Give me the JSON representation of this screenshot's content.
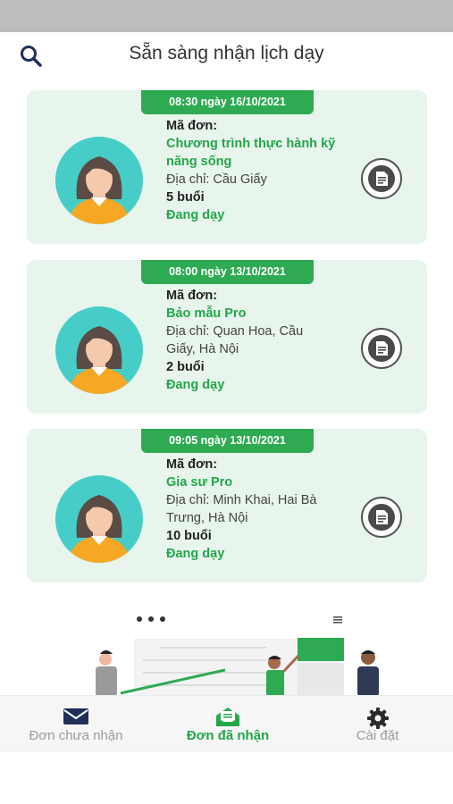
{
  "header": {
    "title": "Sẵn sàng nhận lịch dạy",
    "search_icon": "search-icon"
  },
  "orders": [
    {
      "time": "08:30 ngày 16/10/2021",
      "code_label": "Mã đơn:",
      "service_line1": "Chương trình thực hành kỹ",
      "service_line2": "năng sống",
      "address_line1": "Địa chỉ: Cầu Giấy",
      "address_line2": "",
      "sessions": "5 buổi",
      "status": "Đang dạy"
    },
    {
      "time": "08:00 ngày 13/10/2021",
      "code_label": "Mã đơn:",
      "service_line1": "Bảo mẫu Pro",
      "service_line2": "",
      "address_line1": "Địa chỉ: Quan Hoa, Cầu",
      "address_line2": "Giấy, Hà Nội",
      "sessions": "2 buổi",
      "status": "Đang dạy"
    },
    {
      "time": "09:05 ngày 13/10/2021",
      "code_label": "Mã đơn:",
      "service_line1": "Gia sư Pro",
      "service_line2": "",
      "address_line1": "Địa chỉ: Minh Khai, Hai Bà",
      "address_line2": "Trưng, Hà Nội",
      "sessions": "10 buổi",
      "status": "Đang dạy"
    }
  ],
  "tabs": [
    {
      "label": "Đơn chưa nhận",
      "icon": "envelope-icon",
      "active": false
    },
    {
      "label": "Đơn đã nhận",
      "icon": "envelope-open-icon",
      "active": true
    },
    {
      "label": "Cài đặt",
      "icon": "gear-icon",
      "active": false
    }
  ],
  "colors": {
    "accent": "#2eaa52",
    "card_bg": "#e7f5ec",
    "avatar_bg": "#47cdc7",
    "status_bar": "#bdbdbd"
  }
}
